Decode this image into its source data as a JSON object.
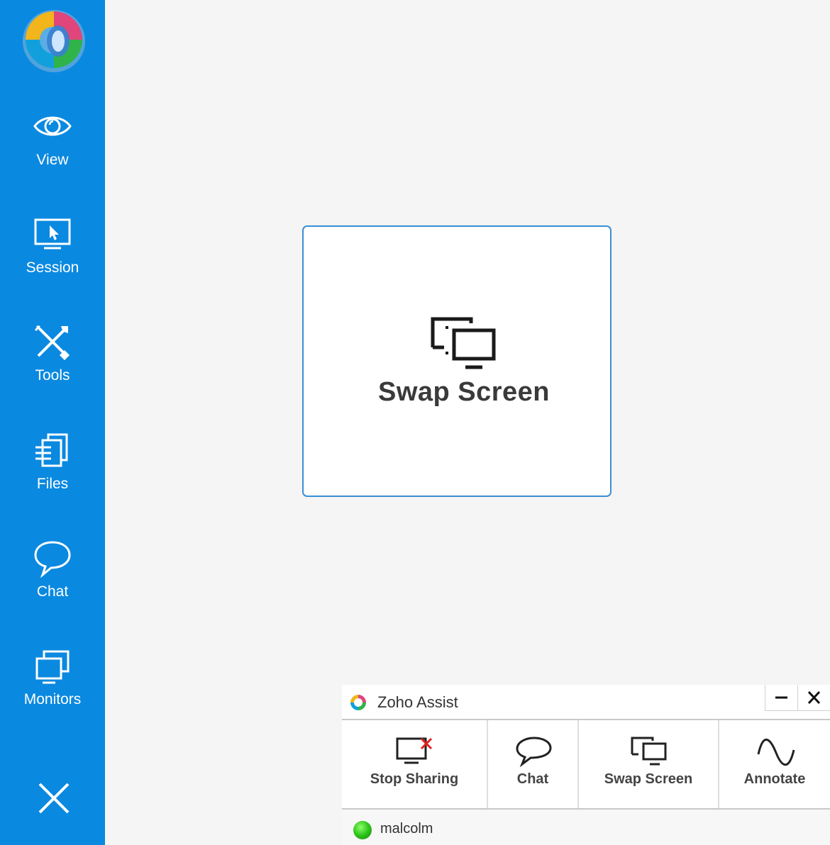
{
  "sidebar": {
    "items": [
      {
        "label": "View",
        "icon": "eye-icon"
      },
      {
        "label": "Session",
        "icon": "monitor-pointer-icon"
      },
      {
        "label": "Tools",
        "icon": "tools-icon"
      },
      {
        "label": "Files",
        "icon": "files-icon"
      },
      {
        "label": "Chat",
        "icon": "chat-bubble-icon"
      },
      {
        "label": "Monitors",
        "icon": "monitors-icon"
      }
    ],
    "close_icon": "close-icon",
    "color": "#0a89e0"
  },
  "card": {
    "label": "Swap Screen",
    "icon": "swap-screen-icon",
    "border_color": "#3a8ed6"
  },
  "zoho_window": {
    "title": "Zoho Assist",
    "tools": [
      {
        "label": "Stop Sharing",
        "icon": "stop-sharing-icon"
      },
      {
        "label": "Chat",
        "icon": "chat-bubble-icon"
      },
      {
        "label": "Swap Screen",
        "icon": "swap-screen-icon"
      },
      {
        "label": "Annotate",
        "icon": "annotate-icon"
      }
    ],
    "user": {
      "name": "malcolm",
      "status_color": "#2ec41a"
    }
  }
}
